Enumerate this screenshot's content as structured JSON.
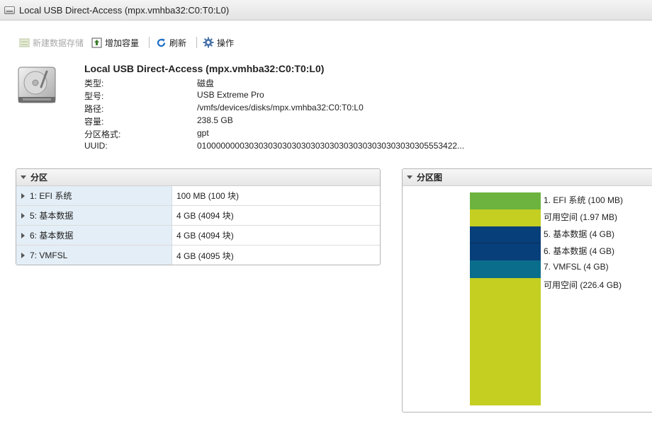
{
  "window": {
    "title": "Local USB Direct-Access (mpx.vmhba32:C0:T0:L0)"
  },
  "toolbar": {
    "new_datastore": "新建数据存储",
    "increase_capacity": "增加容量",
    "refresh": "刷新",
    "actions": "操作"
  },
  "device": {
    "name": "Local USB Direct-Access (mpx.vmhba32:C0:T0:L0)",
    "properties": [
      {
        "label": "类型:",
        "value": "磁盘"
      },
      {
        "label": "型号:",
        "value": "USB Extreme Pro"
      },
      {
        "label": "路径:",
        "value": "/vmfs/devices/disks/mpx.vmhba32:C0:T0:L0"
      },
      {
        "label": "容量:",
        "value": "238.5 GB"
      },
      {
        "label": "分区格式:",
        "value": "gpt"
      },
      {
        "label": "UUID:",
        "value": "0100000000303030303030303030303030303030303030305553422..."
      }
    ]
  },
  "partitions": {
    "title": "分区",
    "rows": [
      {
        "name": "1: EFI 系统",
        "size": "100 MB (100 块)"
      },
      {
        "name": "5: 基本数据",
        "size": "4 GB (4094 块)"
      },
      {
        "name": "6: 基本数据",
        "size": "4 GB (4094 块)"
      },
      {
        "name": "7: VMFSL",
        "size": "4 GB (4095 块)"
      }
    ]
  },
  "diagram": {
    "title": "分区图",
    "segments": [
      {
        "label": "1. EFI 系统 (100 MB)",
        "color": "#6db33f"
      },
      {
        "label": "可用空间 (1.97 MB)",
        "color": "#c4cf22"
      },
      {
        "label": "5. 基本数据 (4 GB)",
        "color": "#073f7a"
      },
      {
        "label": "6. 基本数据 (4 GB)",
        "color": "#073f7a"
      },
      {
        "label": "7. VMFSL (4 GB)",
        "color": "#0a6d8c"
      },
      {
        "label": "可用空间 (226.4 GB)",
        "color": "#c4cf22"
      }
    ]
  }
}
